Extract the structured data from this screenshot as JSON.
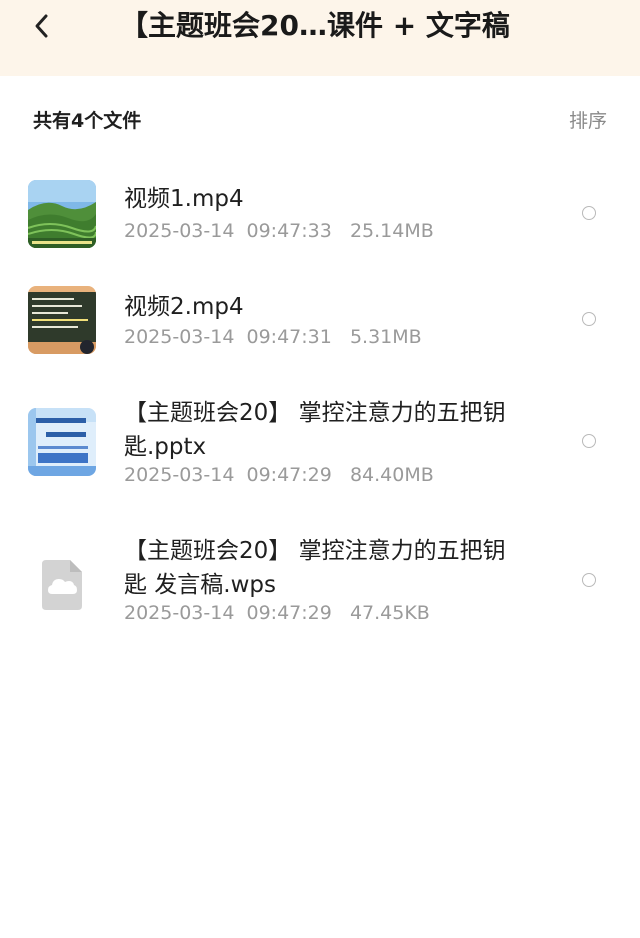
{
  "header": {
    "title": "【主题班会20…课件 + 文字稿"
  },
  "toolbar": {
    "count_text": "共有4个文件",
    "sort_label": "排序"
  },
  "files": [
    {
      "name": "视频1.mp4",
      "meta": "2025-03-14  09:47:33   25.14MB",
      "icon": "video-thumbnail-terraces"
    },
    {
      "name": "视频2.mp4",
      "meta": "2025-03-14  09:47:31   5.31MB",
      "icon": "video-thumbnail-blackboard"
    },
    {
      "name_line1": "【主题班会20】 掌控注意力的五把钥",
      "name_line2": "匙.pptx",
      "meta": "2025-03-14  09:47:29   84.40MB",
      "icon": "pptx-thumbnail"
    },
    {
      "name_line1": "【主题班会20】 掌控注意力的五把钥",
      "name_line2": "匙 发言稿.wps",
      "meta": "2025-03-14  09:47:29   47.45KB",
      "icon": "cloud-document-icon"
    }
  ],
  "colors": {
    "header_bg": "#fdf5ea",
    "text_primary": "#1f1f1f",
    "text_secondary": "#9a9a9a"
  }
}
